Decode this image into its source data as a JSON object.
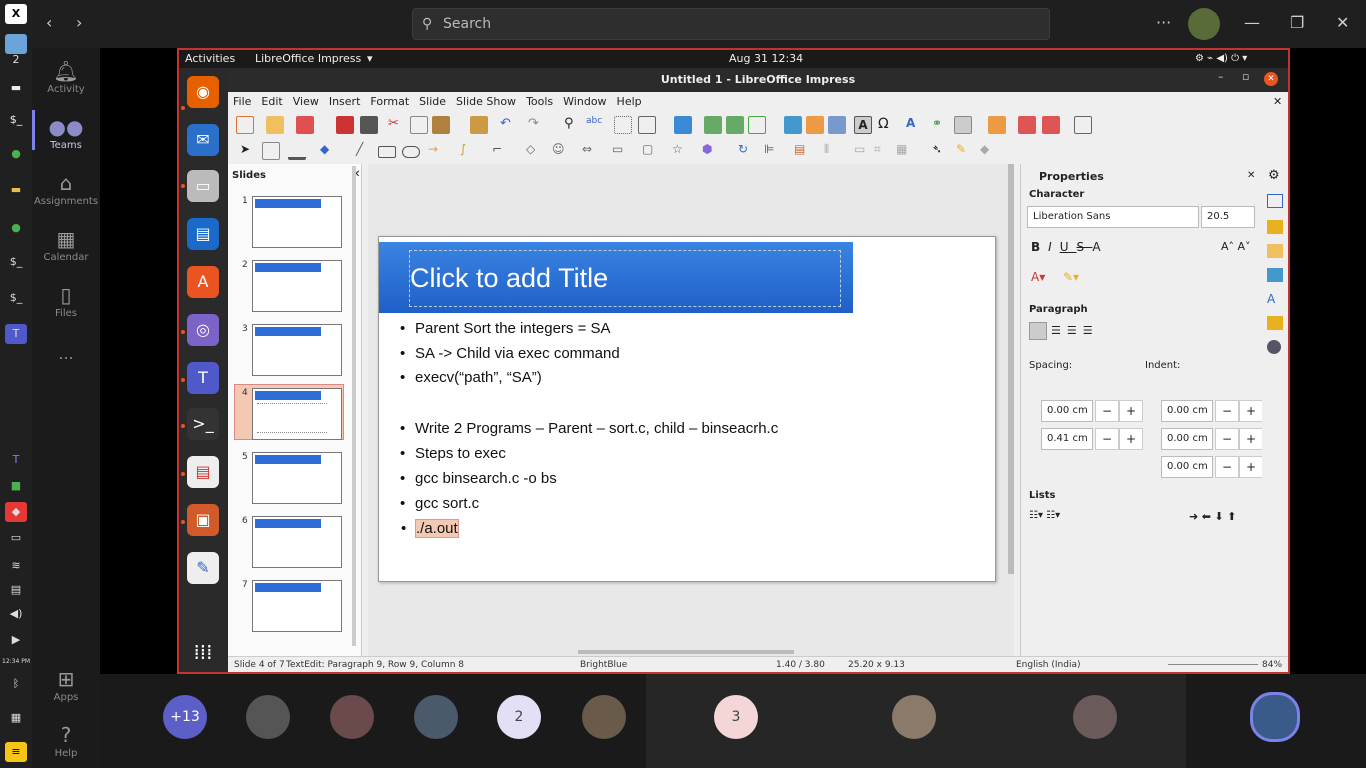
{
  "teams": {
    "search_placeholder": "Search",
    "nav": [
      {
        "label": "Activity"
      },
      {
        "label": "Teams"
      },
      {
        "label": "Assignments"
      },
      {
        "label": "Calendar"
      },
      {
        "label": "Files"
      },
      {
        "label": "Apps"
      },
      {
        "label": "Help"
      }
    ],
    "more": "...",
    "taskbar_badge": "2",
    "taskbar_time": "12:34 PM",
    "participants": [
      {
        "label": "+13"
      },
      {
        "label": "2"
      },
      {
        "label": "3"
      }
    ]
  },
  "gnome": {
    "activities": "Activities",
    "app": "LibreOffice Impress",
    "clock": "Aug 31  12:34"
  },
  "impress": {
    "window_title": "Untitled 1 - LibreOffice Impress",
    "menu": [
      "File",
      "Edit",
      "View",
      "Insert",
      "Format",
      "Slide",
      "Slide Show",
      "Tools",
      "Window",
      "Help"
    ],
    "slides_panel_title": "Slides",
    "slide_numbers": [
      "1",
      "2",
      "3",
      "4",
      "5",
      "6",
      "7"
    ],
    "title_placeholder": "Click to add Title",
    "bullets": [
      "Parent Sort the integers = SA",
      "SA -> Child via exec command",
      "execv(“path”, “SA”)",
      "Write 2 Programs – Parent – sort.c, child – binseacrh.c",
      "Steps to exec",
      "gcc binsearch.c -o bs",
      "gcc sort.c",
      "./a.out"
    ],
    "status": {
      "slide": "Slide 4 of 7",
      "edit": "TextEdit: Paragraph 9, Row 9, Column 8",
      "master": "BrightBlue",
      "pos": "1.40 / 3.80",
      "size": "25.20 x 9.13",
      "lang": "English (India)",
      "zoom": "84%"
    },
    "properties": {
      "title": "Properties",
      "character": "Character",
      "font": "Liberation Sans",
      "font_size": "20.5",
      "paragraph": "Paragraph",
      "spacing": "Spacing:",
      "indent": "Indent:",
      "spacing_above": "0.00 cm",
      "spacing_below": "0.41 cm",
      "indent_before": "0.00 cm",
      "indent_after": "0.00 cm",
      "indent_first": "0.00 cm",
      "lists": "Lists"
    }
  }
}
